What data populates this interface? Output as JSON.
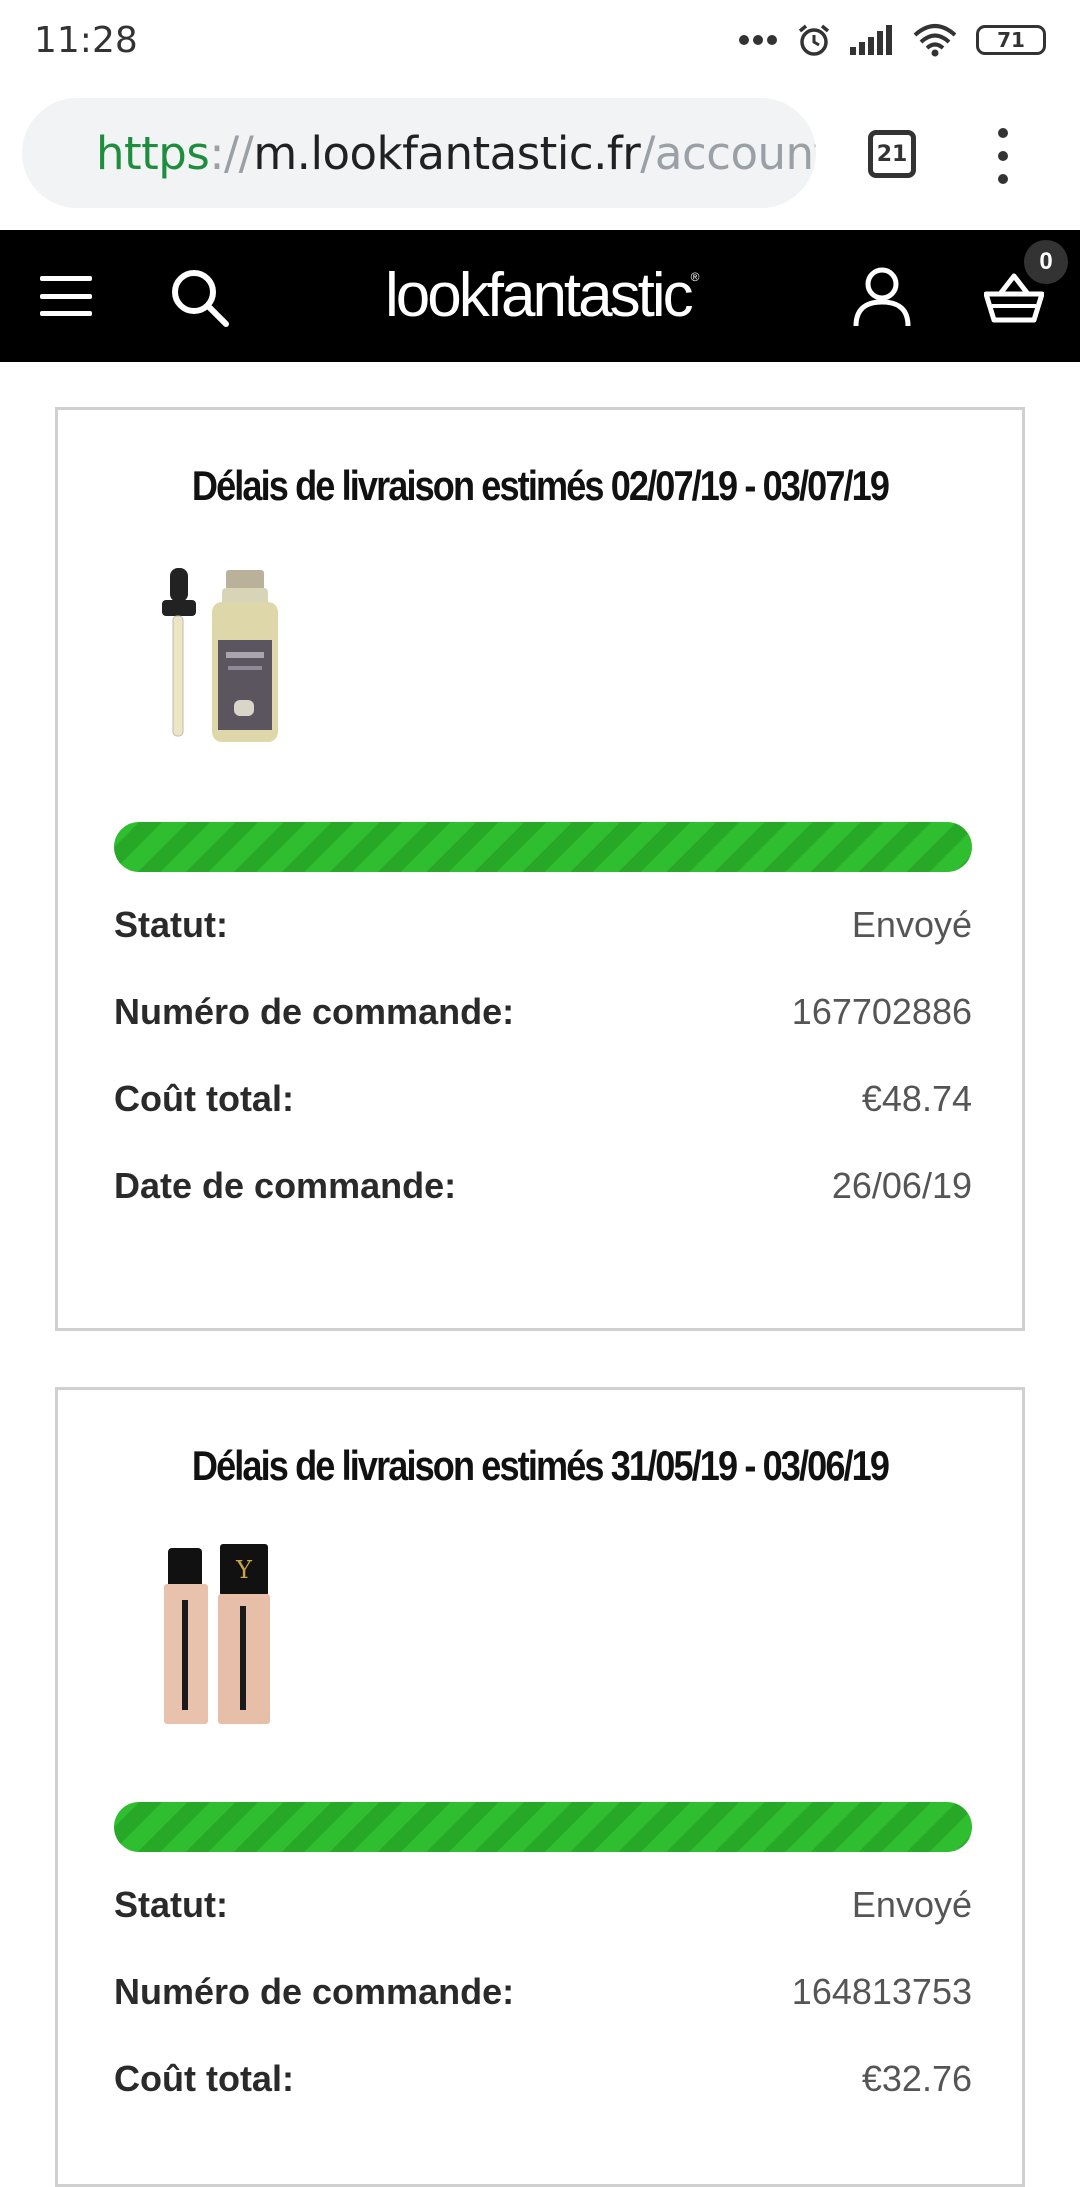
{
  "status_bar": {
    "time": "11:28",
    "battery": "71",
    "icons": [
      "more-dots-icon",
      "alarm-icon",
      "signal-icon",
      "wifi-icon",
      "battery-icon"
    ]
  },
  "browser": {
    "url_scheme": "https",
    "url_separator": "://",
    "url_host": "m.lookfantastic.fr",
    "url_path": "/account",
    "tab_count": "21"
  },
  "site_header": {
    "logo": "lookfantastic",
    "basket_count": "0",
    "background": "#000000"
  },
  "orders": [
    {
      "title": "Délais de livraison estimés 02/07/19 - 03/07/19",
      "product": "dropper-bottle",
      "progress": 1.0,
      "rows": [
        {
          "label": "Statut:",
          "value": "Envoyé"
        },
        {
          "label": "Numéro de commande:",
          "value": "167702886"
        },
        {
          "label": "Coût total:",
          "value": "€48.74"
        },
        {
          "label": "Date de commande:",
          "value": "26/06/19"
        }
      ]
    },
    {
      "title": "Délais de livraison estimés 31/05/19 - 03/06/19",
      "product": "foundation-bottles",
      "progress": 1.0,
      "rows": [
        {
          "label": "Statut:",
          "value": "Envoyé"
        },
        {
          "label": "Numéro de commande:",
          "value": "164813753"
        },
        {
          "label": "Coût total:",
          "value": "€32.76"
        }
      ]
    }
  ],
  "colors": {
    "progress_green": "#2fbe2f",
    "url_green": "#1e8e3e",
    "card_border": "#d0d0d0"
  }
}
